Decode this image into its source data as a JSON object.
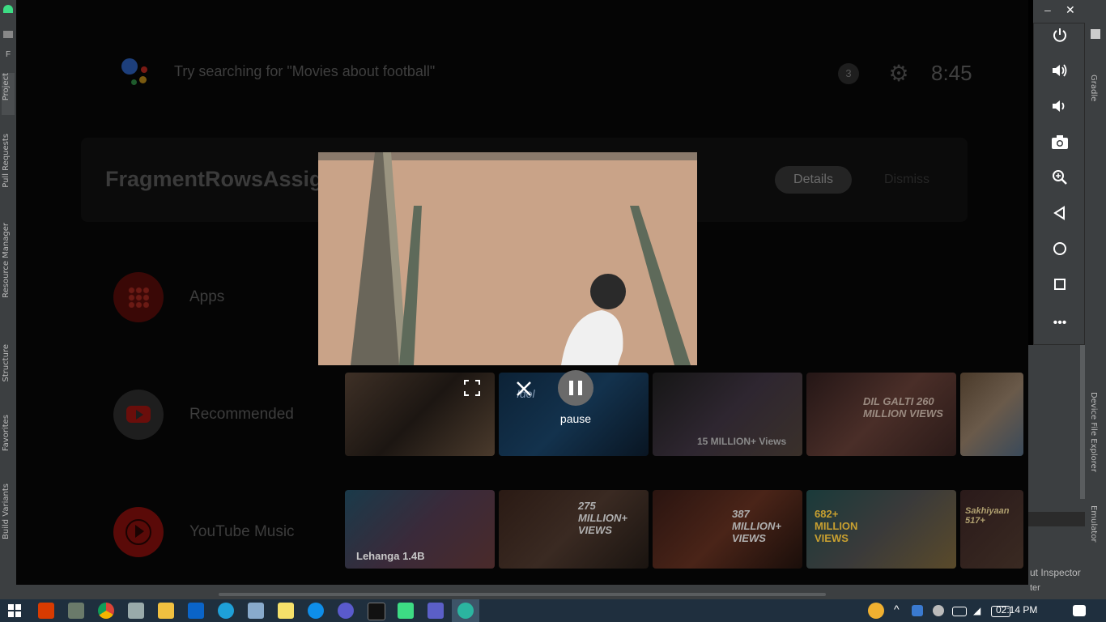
{
  "ide": {
    "left_tabs": [
      "Project",
      "Pull Requests",
      "Resource Manager",
      "Structure",
      "Favorites",
      "Build Variants"
    ],
    "right_tabs": [
      "Gradle",
      "Device File Explorer",
      "Emulator"
    ],
    "bottom_right_text": "ut Inspector",
    "bottom_right_text2": "ter"
  },
  "tv": {
    "search_hint": "Try searching for \"Movies about football\"",
    "notification_count": "3",
    "clock": "8:45",
    "card_title": "FragmentRowsAssignment",
    "details_label": "Details",
    "dismiss_label": "Dismiss",
    "rows": [
      {
        "label": "Apps",
        "icon": "apps-grid-icon"
      },
      {
        "label": "Recommended",
        "icon": "youtube-icon"
      },
      {
        "label": "YouTube Music",
        "icon": "youtube-music-icon"
      }
    ],
    "thumb_texts_row1": [
      "",
      "Idol",
      "15 MILLION+ Views",
      "DIL GALTI 260 MILLION VIEWS",
      ""
    ],
    "thumb_texts_row2": [
      "Lehanga 1.4B",
      "275 MILLION+ VIEWS",
      "387 MILLION+ VIEWS",
      "682+ MILLION VIEWS",
      "Sakhiyaan 517+"
    ]
  },
  "pip": {
    "pause_label": "pause"
  },
  "emulator": {
    "buttons": [
      "power-icon",
      "volume-up-icon",
      "volume-down-icon",
      "camera-icon",
      "zoom-icon",
      "back-icon",
      "home-icon",
      "overview-icon",
      "more-icon"
    ]
  },
  "taskbar": {
    "time": "02:14 PM"
  }
}
